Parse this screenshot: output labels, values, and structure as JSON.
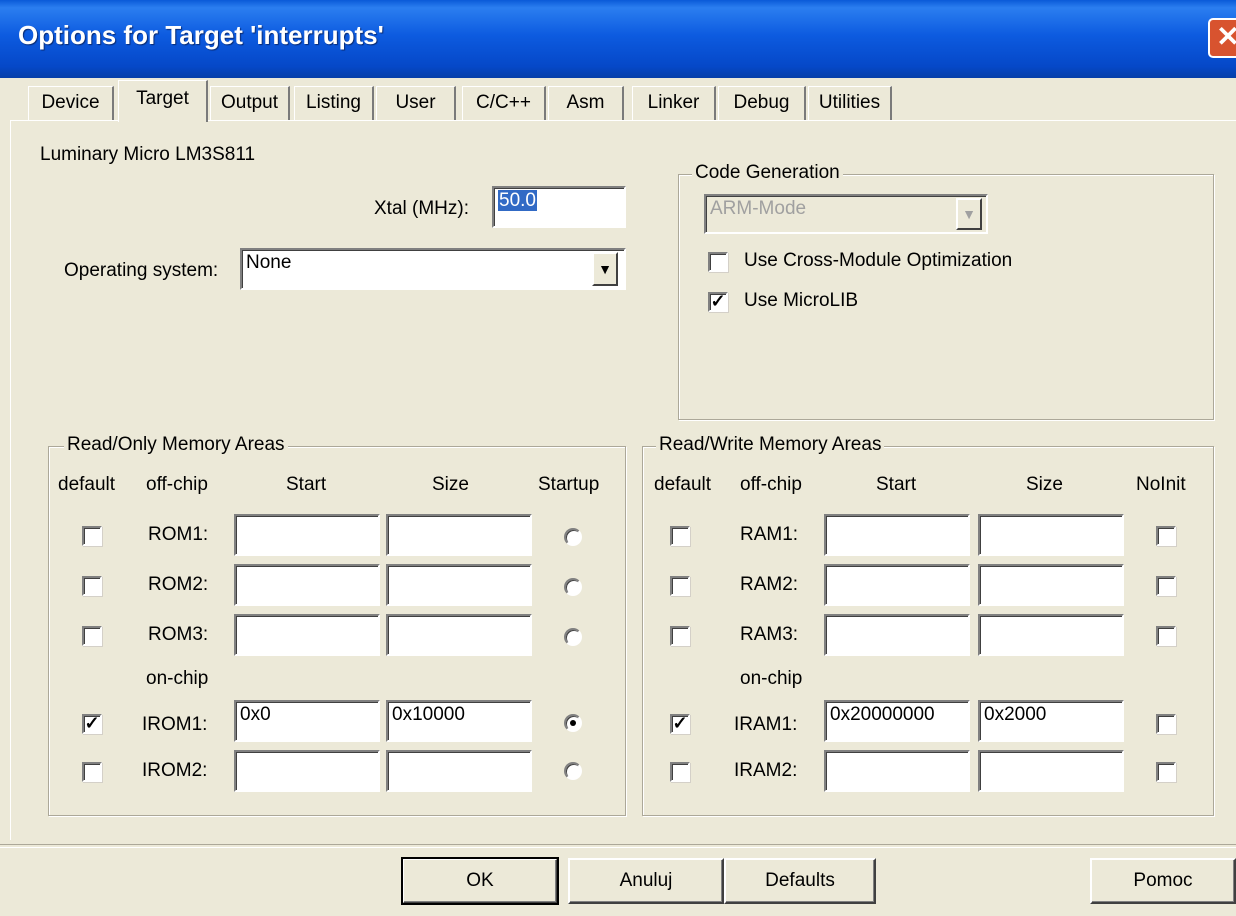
{
  "window": {
    "title": "Options for Target 'interrupts'",
    "close_glyph": "✕"
  },
  "tabs": [
    "Device",
    "Target",
    "Output",
    "Listing",
    "User",
    "C/C++",
    "Asm",
    "Linker",
    "Debug",
    "Utilities"
  ],
  "active_tab": "Target",
  "target": {
    "device_name": "Luminary Micro LM3S811",
    "xtal_label": "Xtal (MHz):",
    "xtal_value": "50.0",
    "os_label": "Operating system:",
    "os_value": "None"
  },
  "code_generation": {
    "title": "Code Generation",
    "mode_value": "ARM-Mode",
    "cross_module_label": "Use Cross-Module Optimization",
    "cross_module_checked": false,
    "microlib_label": "Use MicroLIB",
    "microlib_checked": true
  },
  "rom_areas": {
    "title": "Read/Only Memory Areas",
    "headers": {
      "default": "default",
      "offchip": "off-chip",
      "start": "Start",
      "size": "Size",
      "last": "Startup"
    },
    "onchip_label": "on-chip",
    "rows": [
      {
        "label": "ROM1:",
        "start": "",
        "size": "",
        "default": false,
        "startup": false
      },
      {
        "label": "ROM2:",
        "start": "",
        "size": "",
        "default": false,
        "startup": false
      },
      {
        "label": "ROM3:",
        "start": "",
        "size": "",
        "default": false,
        "startup": false
      },
      {
        "label": "IROM1:",
        "start": "0x0",
        "size": "0x10000",
        "default": true,
        "startup": true
      },
      {
        "label": "IROM2:",
        "start": "",
        "size": "",
        "default": false,
        "startup": false
      }
    ]
  },
  "ram_areas": {
    "title": "Read/Write Memory Areas",
    "headers": {
      "default": "default",
      "offchip": "off-chip",
      "start": "Start",
      "size": "Size",
      "last": "NoInit"
    },
    "onchip_label": "on-chip",
    "rows": [
      {
        "label": "RAM1:",
        "start": "",
        "size": "",
        "default": false,
        "noinit": false
      },
      {
        "label": "RAM2:",
        "start": "",
        "size": "",
        "default": false,
        "noinit": false
      },
      {
        "label": "RAM3:",
        "start": "",
        "size": "",
        "default": false,
        "noinit": false
      },
      {
        "label": "IRAM1:",
        "start": "0x20000000",
        "size": "0x2000",
        "default": true,
        "noinit": false
      },
      {
        "label": "IRAM2:",
        "start": "",
        "size": "",
        "default": false,
        "noinit": false
      }
    ]
  },
  "buttons": {
    "ok": "OK",
    "cancel": "Anuluj",
    "defaults": "Defaults",
    "help": "Pomoc"
  },
  "icons": {
    "dropdown": "chevron-down-icon",
    "check": "checkmark-icon",
    "close": "close-icon"
  },
  "colors": {
    "titlebar": "#0a5ad8",
    "dialog_bg": "#ece9d8",
    "close": "#d8532f",
    "selection": "#316ac5"
  }
}
